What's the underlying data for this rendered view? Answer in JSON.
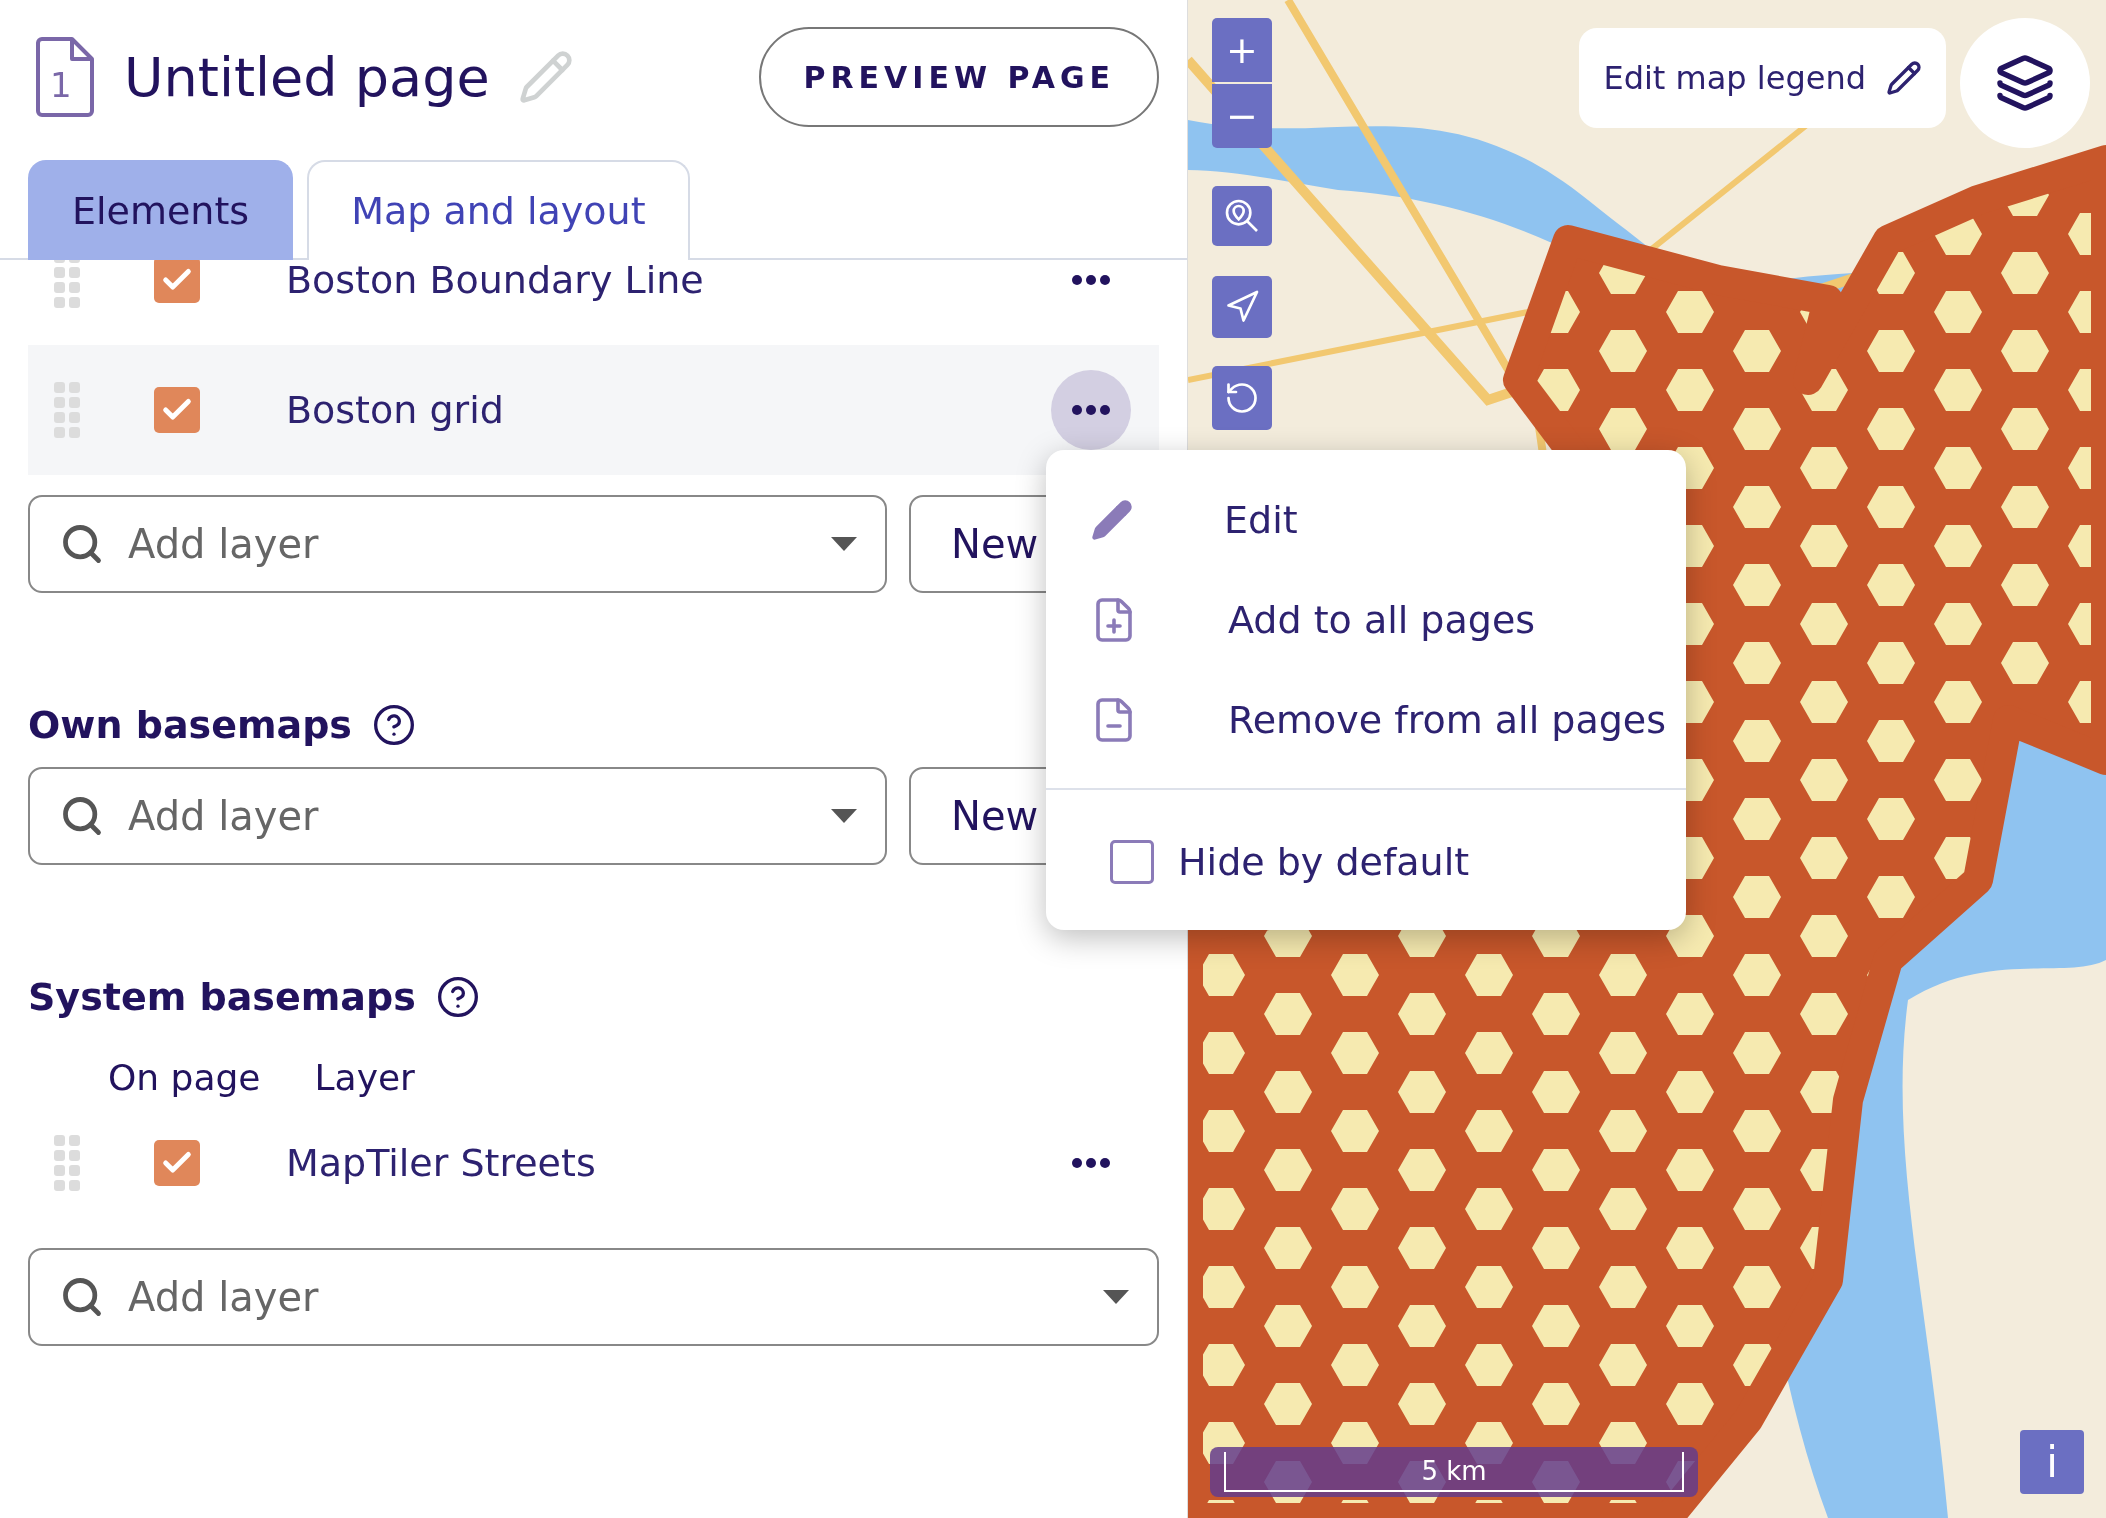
{
  "header": {
    "page_number": "1",
    "title": "Untitled page",
    "preview_button": "PREVIEW PAGE"
  },
  "tabs": [
    {
      "label": "Elements",
      "selected": true
    },
    {
      "label": "Map and layout",
      "selected": false
    }
  ],
  "layers": [
    {
      "name": "Boston Boundary Line",
      "checked": true,
      "menu_open": false
    },
    {
      "name": "Boston grid",
      "checked": true,
      "menu_open": true
    }
  ],
  "layers_add": {
    "placeholder": "Add layer",
    "new_button": "New"
  },
  "own_basemaps": {
    "title": "Own basemaps",
    "add": {
      "placeholder": "Add layer",
      "new_button": "New"
    }
  },
  "system_basemaps": {
    "title": "System basemaps",
    "columns": [
      "On page",
      "Layer"
    ],
    "rows": [
      {
        "name": "MapTiler Streets",
        "checked": true
      }
    ],
    "add": {
      "placeholder": "Add layer"
    }
  },
  "context_menu": {
    "items": [
      {
        "kind": "edit",
        "label": "Edit"
      },
      {
        "kind": "add_pages",
        "label": "Add to all pages"
      },
      {
        "kind": "remove_pages",
        "label": "Remove from all pages"
      },
      {
        "kind": "checkbox",
        "label": "Hide by default",
        "checked": false
      }
    ]
  },
  "map": {
    "zoom_in": "+",
    "zoom_out": "−",
    "legend_button": "Edit map legend",
    "scale": "5 km",
    "info": "i"
  }
}
